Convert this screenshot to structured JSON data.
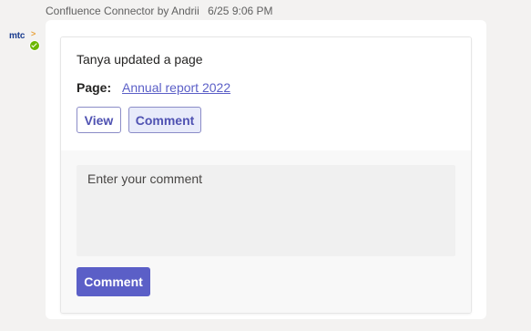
{
  "sender": {
    "avatar_text": "mtc",
    "avatar_arrow": ">",
    "name_line": "Confluence Connector by Andrii",
    "timestamp": "6/25 9:06 PM",
    "status_color": "#6bb700"
  },
  "card": {
    "headline": "Tanya updated a page",
    "page_label": "Page:",
    "page_link": "Annual report 2022",
    "view_button": "View",
    "comment_toggle_button": "Comment",
    "comment_placeholder": "Enter your comment",
    "comment_submit_button": "Comment"
  },
  "colors": {
    "accent": "#5b5fc7",
    "background": "#f3f2f1"
  }
}
